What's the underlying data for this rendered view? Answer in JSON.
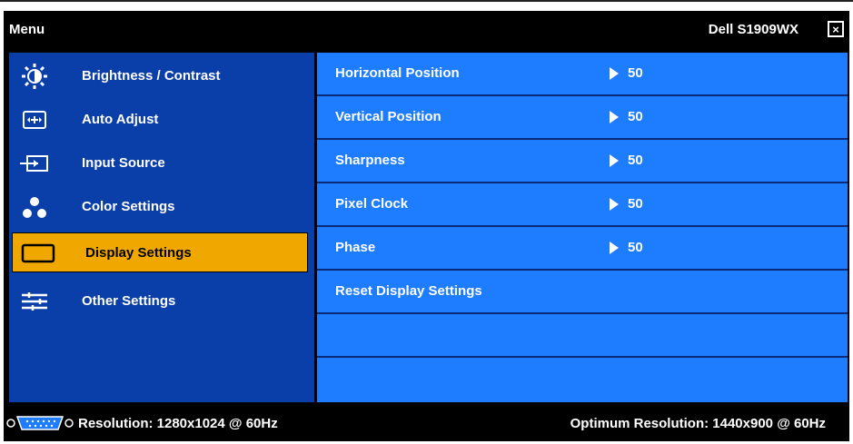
{
  "header": {
    "menu_title": "Menu",
    "model": "Dell S1909WX",
    "close_glyph": "×"
  },
  "sidebar": {
    "items": [
      {
        "label": "Brightness / Contrast",
        "icon": "brightness-icon"
      },
      {
        "label": "Auto Adjust",
        "icon": "auto-adjust-icon"
      },
      {
        "label": "Input Source",
        "icon": "input-source-icon"
      },
      {
        "label": "Color Settings",
        "icon": "color-settings-icon"
      },
      {
        "label": "Display Settings",
        "icon": "display-settings-icon",
        "selected": true
      },
      {
        "label": "Other Settings",
        "icon": "other-settings-icon"
      }
    ]
  },
  "panel": {
    "rows": [
      {
        "label": "Horizontal Position",
        "value": "50"
      },
      {
        "label": "Vertical Position",
        "value": "50"
      },
      {
        "label": "Sharpness",
        "value": "50"
      },
      {
        "label": "Pixel Clock",
        "value": "50"
      },
      {
        "label": "Phase",
        "value": "50"
      },
      {
        "label": "Reset Display Settings",
        "value": ""
      },
      {
        "label": "",
        "value": ""
      },
      {
        "label": "",
        "value": ""
      }
    ]
  },
  "footer": {
    "resolution": "Resolution: 1280x1024 @ 60Hz",
    "optimum": "Optimum Resolution: 1440x900 @ 60Hz",
    "connector_icon": "vga-connector-icon"
  },
  "colors": {
    "sidebar_bg": "#0a3ea8",
    "panel_bg": "#1e7cff",
    "selected_bg": "#f0a800",
    "frame_bg": "#000000"
  }
}
